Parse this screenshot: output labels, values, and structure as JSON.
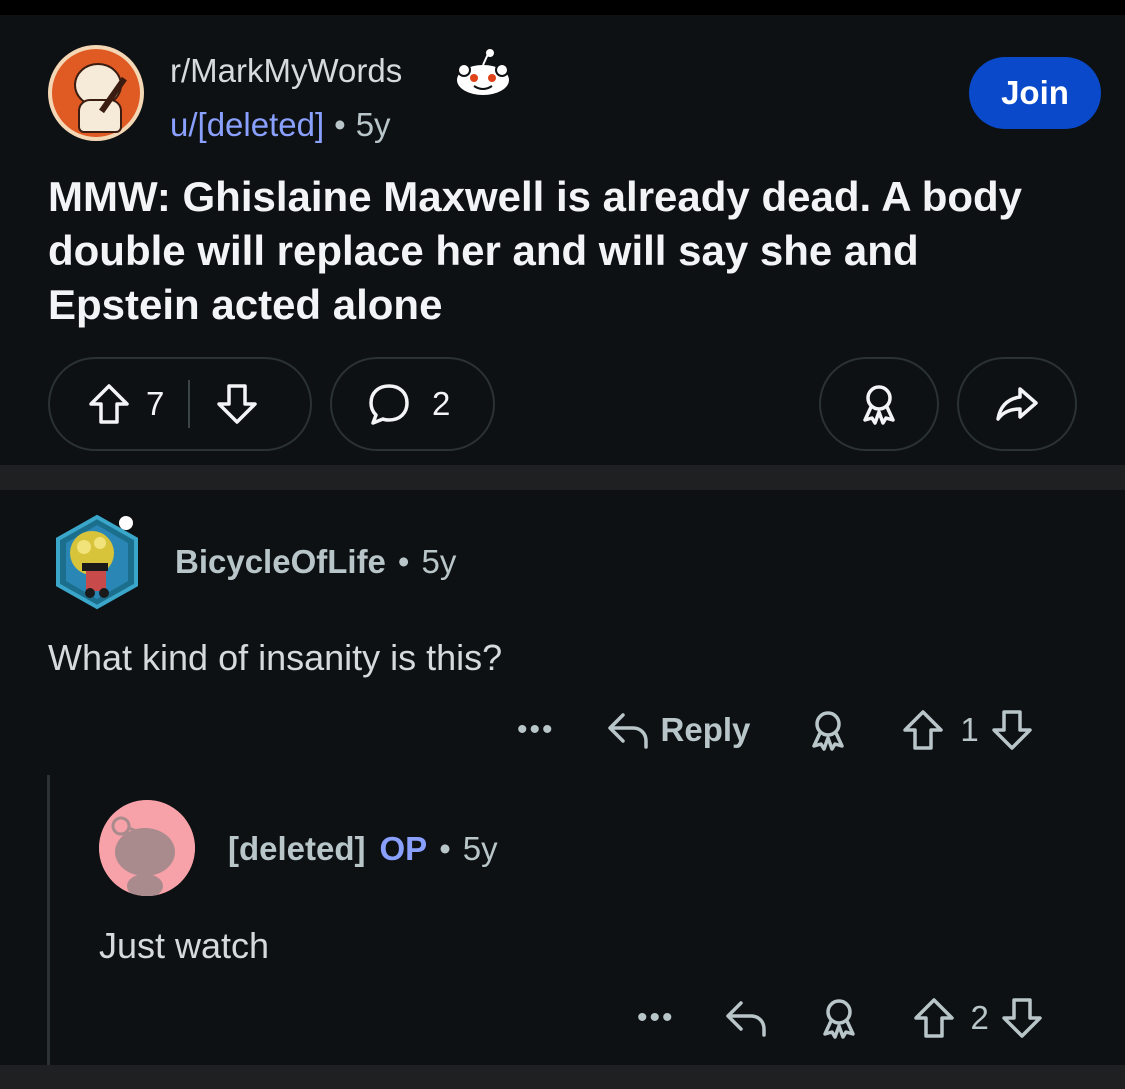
{
  "post": {
    "subreddit": "r/MarkMyWords",
    "author": "u/[deleted]",
    "separator": "•",
    "age": "5y",
    "join_label": "Join",
    "title": "MMW: Ghislaine Maxwell is already dead. A body double will replace her and will say she and Epstein acted alone",
    "upvotes": "7",
    "comments": "2"
  },
  "comments": [
    {
      "author": "BicycleOfLife",
      "separator": "•",
      "age": "5y",
      "body": "What kind of insanity is this?",
      "more_label": "•••",
      "reply_label": "Reply",
      "score": "1"
    },
    {
      "author": "[deleted]",
      "op_badge": "OP",
      "separator": "•",
      "age": "5y",
      "body": "Just watch",
      "more_label": "•••",
      "score": "2"
    }
  ],
  "colors": {
    "background": "#0e1113",
    "join_button": "#0a49c9",
    "link_blue": "#8aa0ff",
    "muted_text": "#b8c5c9",
    "pill_border": "#2a3236"
  },
  "icons": [
    "upvote-icon",
    "downvote-icon",
    "comment-icon",
    "award-icon",
    "share-icon",
    "reply-icon",
    "more-icon"
  ]
}
